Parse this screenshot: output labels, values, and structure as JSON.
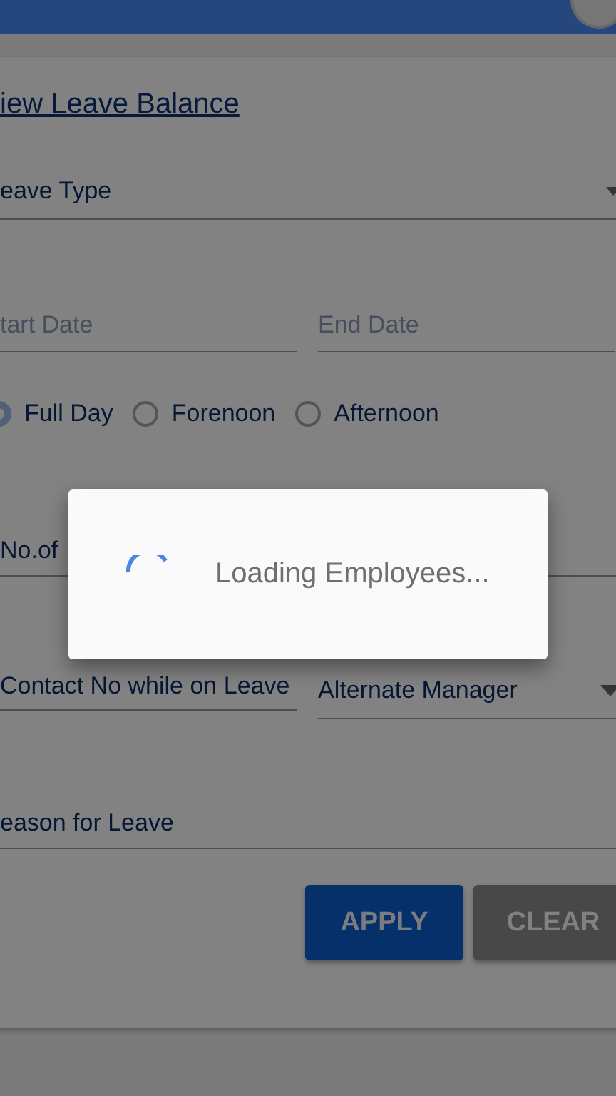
{
  "leave_balance_link": "iew Leave Balance",
  "leave_type": {
    "label": "eave Type"
  },
  "start_date": {
    "placeholder": "tart Date"
  },
  "end_date": {
    "placeholder": "End Date"
  },
  "day_options": [
    {
      "label": "Full Day",
      "selected": true
    },
    {
      "label": "Forenoon",
      "selected": false
    },
    {
      "label": "Afternoon",
      "selected": false
    }
  ],
  "no_of_days": {
    "label": "No.of"
  },
  "contact_no": {
    "label": "Contact No while on Leave"
  },
  "alternate_manager": {
    "label": "Alternate Manager"
  },
  "reason": {
    "label": "eason for Leave"
  },
  "buttons": [
    {
      "label": "APPLY",
      "kind": "primary"
    },
    {
      "label": "CLEAR",
      "kind": "secondary"
    }
  ],
  "dialog": {
    "message": "Loading Employees..."
  }
}
